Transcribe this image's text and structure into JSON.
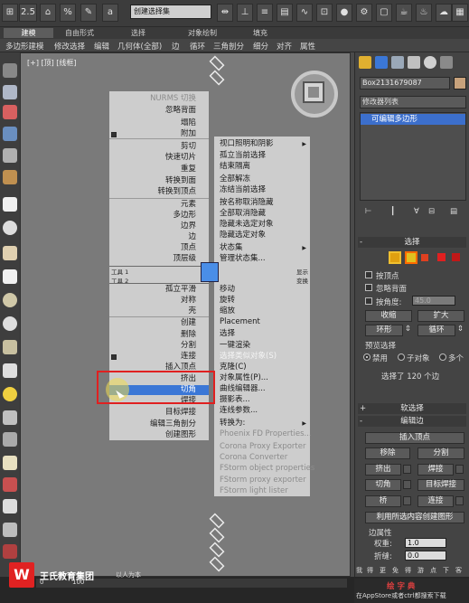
{
  "toolbar": {
    "num1": "2.5",
    "num2": "%",
    "field_selection": "创建选择集",
    "dropdown_view": "视图"
  },
  "ribbon_tabs": [
    "建模",
    "自由形式",
    "选择",
    "对象绘制",
    "填充"
  ],
  "ribbon_sub": [
    "多边形建模",
    "修改选择",
    "编辑",
    "几何体(全部)",
    "边",
    "循环",
    "三角剖分",
    "细分",
    "对齐",
    "属性"
  ],
  "viewport": {
    "label": "[+] [顶] [线框]"
  },
  "quad_left": {
    "items": [
      {
        "label": "NURMS 切换",
        "state": "gray"
      },
      {
        "label": "忽略背面",
        "state": "normal"
      },
      {
        "label": "塌陷",
        "state": "normal"
      },
      {
        "label": "附加",
        "state": "normal"
      },
      {
        "label": "剪切",
        "state": "normal"
      },
      {
        "label": "快速切片",
        "state": "normal"
      },
      {
        "label": "重复",
        "state": "normal"
      },
      {
        "label": "转换到面",
        "state": "normal"
      },
      {
        "label": "转换到顶点",
        "state": "normal"
      },
      {
        "label": "元素",
        "state": "normal"
      },
      {
        "label": "多边形",
        "state": "normal"
      },
      {
        "label": "边界",
        "state": "normal"
      },
      {
        "label": "边",
        "state": "normal"
      },
      {
        "label": "顶点",
        "state": "normal"
      },
      {
        "label": "顶层级",
        "state": "normal"
      }
    ],
    "header1": "工具 1",
    "header2": "工具 2",
    "items2": [
      {
        "label": "孤立平滑",
        "state": "normal"
      },
      {
        "label": "对称",
        "state": "normal"
      },
      {
        "label": "壳",
        "state": "normal"
      },
      {
        "label": "创建",
        "state": "normal"
      },
      {
        "label": "删除",
        "state": "normal"
      },
      {
        "label": "分割",
        "state": "normal"
      },
      {
        "label": "连接",
        "state": "normal"
      },
      {
        "label": "插入顶点",
        "state": "normal"
      },
      {
        "label": "挤出",
        "state": "normal"
      },
      {
        "label": "切角",
        "state": "selected"
      },
      {
        "label": "焊接",
        "state": "normal"
      },
      {
        "label": "目标焊接",
        "state": "normal"
      },
      {
        "label": "编辑三角剖分",
        "state": "normal"
      },
      {
        "label": "创建图形",
        "state": "normal"
      }
    ]
  },
  "quad_right": {
    "items": [
      {
        "label": "视口照明和阴影",
        "state": "normal"
      },
      {
        "label": "孤立当前选择",
        "state": "normal"
      },
      {
        "label": "结束隔离",
        "state": "normal"
      },
      {
        "label": "全部解冻",
        "state": "normal"
      },
      {
        "label": "冻结当前选择",
        "state": "normal"
      },
      {
        "label": "按名称取消隐藏",
        "state": "normal"
      },
      {
        "label": "全部取消隐藏",
        "state": "normal"
      },
      {
        "label": "隐藏未选定对象",
        "state": "normal"
      },
      {
        "label": "隐藏选定对象",
        "state": "normal"
      },
      {
        "label": "状态集",
        "state": "normal"
      },
      {
        "label": "管理状态集...",
        "state": "normal"
      }
    ],
    "header1": "显示",
    "header2": "变换",
    "items2": [
      {
        "label": "移动",
        "state": "normal"
      },
      {
        "label": "旋转",
        "state": "normal"
      },
      {
        "label": "缩放",
        "state": "normal"
      },
      {
        "label": "Placement",
        "state": "normal"
      },
      {
        "label": "选择",
        "state": "normal"
      },
      {
        "label": "一键渲染",
        "state": "normal"
      },
      {
        "label": "选择类似对象(S)",
        "state": "faint"
      },
      {
        "label": "克隆(C)",
        "state": "normal"
      },
      {
        "label": "对象属性(P)...",
        "state": "normal"
      },
      {
        "label": "曲线编辑器...",
        "state": "normal"
      },
      {
        "label": "摄影表...",
        "state": "normal"
      },
      {
        "label": "连线参数...",
        "state": "normal"
      },
      {
        "label": "转换为:",
        "state": "normal"
      },
      {
        "label": "Phoenix FD Properties...",
        "state": "gray"
      },
      {
        "label": "Corona Proxy Exporter",
        "state": "gray"
      },
      {
        "label": "Corona Converter",
        "state": "gray"
      },
      {
        "label": "FStorm object properties",
        "state": "gray"
      },
      {
        "label": "FStorm proxy exporter",
        "state": "gray"
      },
      {
        "label": "FStorm light lister",
        "state": "gray"
      }
    ]
  },
  "right_panel": {
    "object_name": "Box2131679087",
    "modifier_list": "修改器列表",
    "stack_item": "可编辑多边形",
    "rollout_select": "选择",
    "by_vertex": "按顶点",
    "ignore_backface": "忽略背面",
    "by_angle": "按角度:",
    "angle_value": "45.0",
    "shrink": "收缩",
    "grow": "扩大",
    "ring": "环形",
    "loop": "循环",
    "preview_select": "预览选择",
    "disable": "禁用",
    "subobject": "子对象",
    "multi": "多个",
    "selected_info": "选择了 120 个边",
    "soft_select": "软选择",
    "edit_edges": "编辑边",
    "insert_vertex": "插入顶点",
    "remove": "移除",
    "split": "分割",
    "extrude": "挤出",
    "weld": "焊接",
    "chamfer": "切角",
    "target_weld": "目标焊接",
    "bridge": "桥",
    "connect": "连接",
    "create_shape": "利用所选内容创建图形",
    "edge_props": "边属性",
    "weight": "权重:",
    "weight_val": "1.0",
    "crease": "折缝:",
    "crease_val": "0.0"
  },
  "bottom": {
    "logo": "W",
    "brand": "王氏教育集团",
    "slogan": "以人为本",
    "ruler": [
      "0",
      "100"
    ],
    "appstore": "在AppStore或者ctrl都搜索下载",
    "bottom_right_icons": [
      "我",
      "得",
      "更",
      "免",
      "得",
      "游",
      "点",
      "下",
      "客"
    ],
    "green_text": "绘 字 典"
  },
  "colors": {
    "accent": "#3b77d6",
    "highlight_box": "#e02020",
    "menu_bg": "#cdcdcd"
  }
}
